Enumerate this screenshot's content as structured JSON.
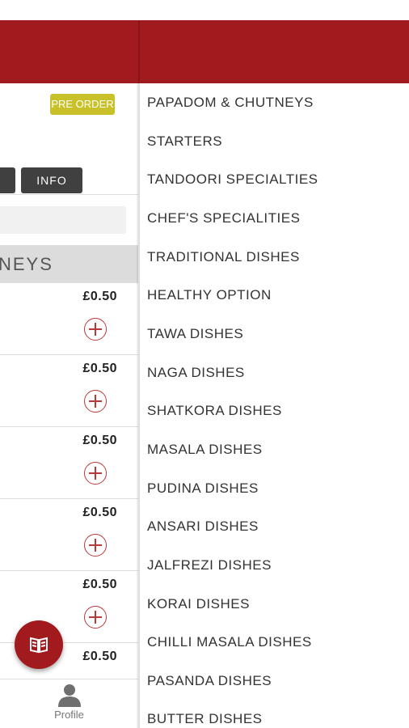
{
  "header": {
    "color": "#a01a1e"
  },
  "left_panel": {
    "preorder_badge": "PRE ORDER",
    "info_button": "INFO",
    "category_heading": "NEYS",
    "items": [
      {
        "price": "£0.50"
      },
      {
        "price": "£0.50"
      },
      {
        "price": "£0.50"
      },
      {
        "price": "£0.50"
      },
      {
        "price": "£0.50"
      },
      {
        "price": "£0.50"
      }
    ],
    "fab_icon": "menu-book-icon",
    "tab_profile": "Profile"
  },
  "drawer": {
    "categories": [
      "PAPADOM & CHUTNEYS",
      "STARTERS",
      "TANDOORI SPECIALTIES",
      "CHEF'S SPECIALITIES",
      "TRADITIONAL DISHES",
      "HEALTHY OPTION",
      "TAWA DISHES",
      "NAGA DISHES",
      "SHATKORA DISHES",
      "MASALA DISHES",
      "PUDINA DISHES",
      "ANSARI DISHES",
      "JALFREZI DISHES",
      "KORAI DISHES",
      "CHILLI MASALA DISHES",
      "PASANDA DISHES",
      "BUTTER DISHES"
    ]
  }
}
